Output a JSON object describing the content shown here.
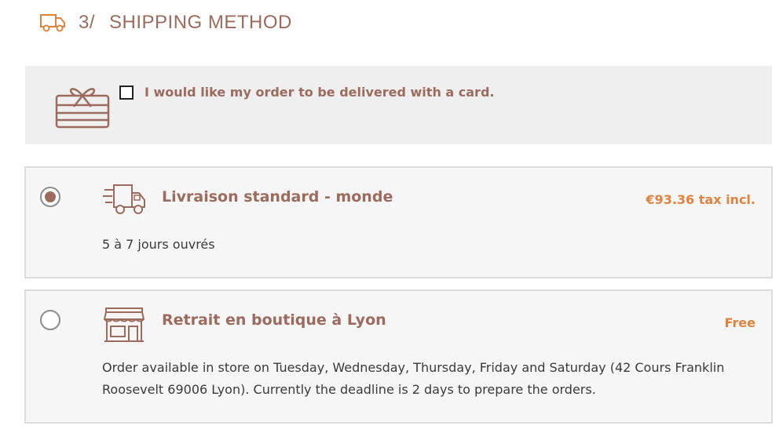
{
  "step": {
    "number": "3/",
    "title": "SHIPPING METHOD",
    "icon": "truck-icon"
  },
  "gift_card": {
    "label": "I would like my order to be delivered with a card.",
    "checked": false,
    "icon": "gift-card-icon"
  },
  "carriers": [
    {
      "name": "Livraison standard - monde",
      "price": "€93.36 tax incl.",
      "delay": "5 à 7 jours ouvrés",
      "selected": true,
      "icon": "fast-delivery-truck-icon"
    },
    {
      "name": "Retrait en boutique à Lyon",
      "price": "Free",
      "delay": "Order available in store on Tuesday, Wednesday, Thursday, Friday and Saturday (42 Cours Franklin Roosevelt 69006 Lyon). Currently the deadline is 2 days to prepare the orders.",
      "selected": false,
      "icon": "storefront-icon"
    }
  ],
  "colors": {
    "brand": "#9c6b5e",
    "price": "#e0833f",
    "icon_accent": "#e0833f"
  }
}
